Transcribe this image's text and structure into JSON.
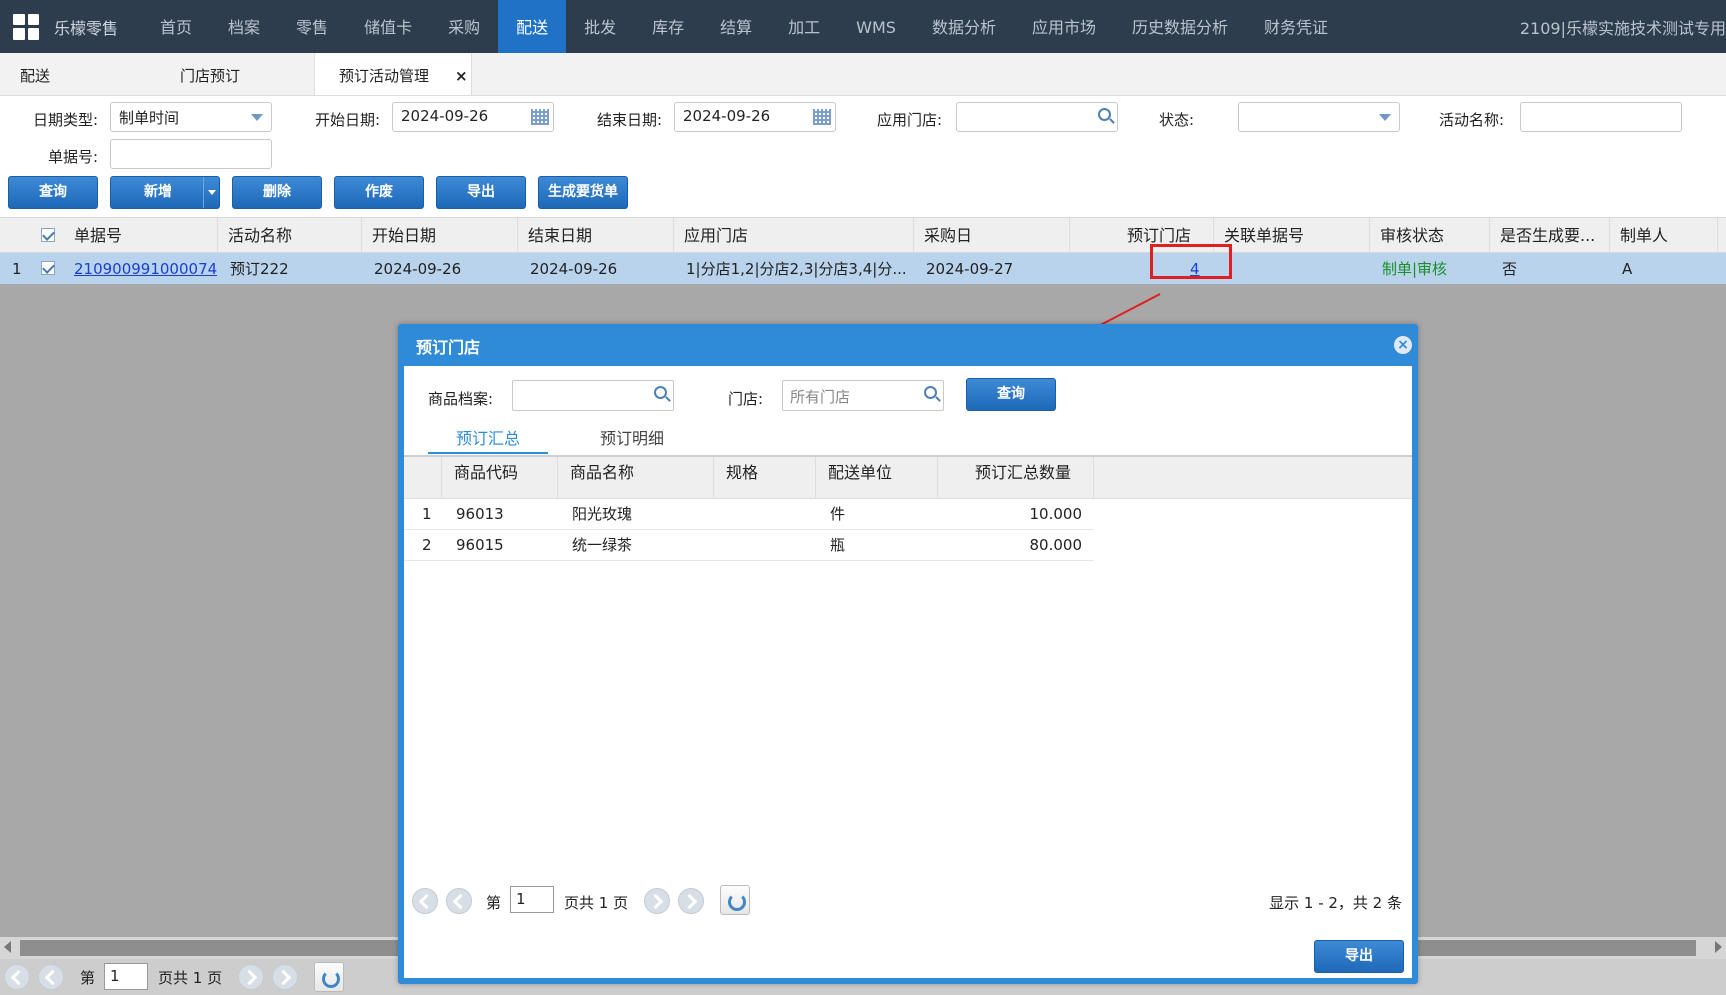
{
  "nav": {
    "brand": "乐檬零售",
    "items": [
      "首页",
      "档案",
      "零售",
      "储值卡",
      "采购",
      "配送",
      "批发",
      "库存",
      "结算",
      "加工",
      "WMS",
      "数据分析",
      "应用市场",
      "历史数据分析",
      "财务凭证"
    ],
    "active": "配送",
    "account": "2109|乐檬实施技术测试专用"
  },
  "tabs": {
    "t1": "配送",
    "t2": "门店预订",
    "t3": "预订活动管理",
    "close": "×"
  },
  "filters": {
    "date_type_label": "日期类型:",
    "date_type_value": "制单时间",
    "start_label": "开始日期:",
    "start_value": "2024-09-26",
    "end_label": "结束日期:",
    "end_value": "2024-09-26",
    "store_label": "应用门店:",
    "status_label": "状态:",
    "activity_label": "活动名称:",
    "doc_label": "单据号:"
  },
  "actions": {
    "query": "查询",
    "add": "新增",
    "delete": "删除",
    "void": "作废",
    "export": "导出",
    "generate": "生成要货单"
  },
  "grid": {
    "headers": [
      "单据号",
      "活动名称",
      "开始日期",
      "结束日期",
      "应用门店",
      "采购日",
      "预订门店",
      "关联单据号",
      "审核状态",
      "是否生成要...",
      "制单人"
    ],
    "row": {
      "index": "1",
      "doc_no": "210900991000074",
      "activity": "预订222",
      "start": "2024-09-26",
      "end": "2024-09-26",
      "stores": "1|分店1,2|分店2,3|分店3,4|分...",
      "purchase_day": "2024-09-27",
      "store_count": "4",
      "related_doc": "",
      "status": "制单|审核",
      "generated": "否",
      "creator": "A"
    }
  },
  "pager": {
    "page_prefix": "第",
    "page_value": "1",
    "page_suffix": "页共 1 页"
  },
  "dialog": {
    "title": "预订门店",
    "close": "×",
    "product_label": "商品档案:",
    "store_label": "门店:",
    "store_placeholder": "所有门店",
    "query": "查询",
    "tabs": [
      "预订汇总",
      "预订明细"
    ],
    "headers": [
      "商品代码",
      "商品名称",
      "规格",
      "配送单位",
      "预订汇总数量"
    ],
    "rows": [
      {
        "index": "1",
        "code": "96013",
        "name": "阳光玫瑰",
        "spec": "",
        "unit": "件",
        "qty": "10.000"
      },
      {
        "index": "2",
        "code": "96015",
        "name": "统一绿茶",
        "spec": "",
        "unit": "瓶",
        "qty": "80.000"
      }
    ],
    "pager": {
      "page_prefix": "第",
      "page_value": "1",
      "page_suffix": "页共 1 页",
      "summary": "显示 1 - 2，共 2 条"
    },
    "export": "导出"
  },
  "colors": {
    "nav_bg": "#2e3d4e",
    "nav_active": "#1f72c6",
    "row_selected": "#b9d3ec",
    "dialog_header": "#2f8ad8",
    "highlight_box": "#e02020"
  }
}
